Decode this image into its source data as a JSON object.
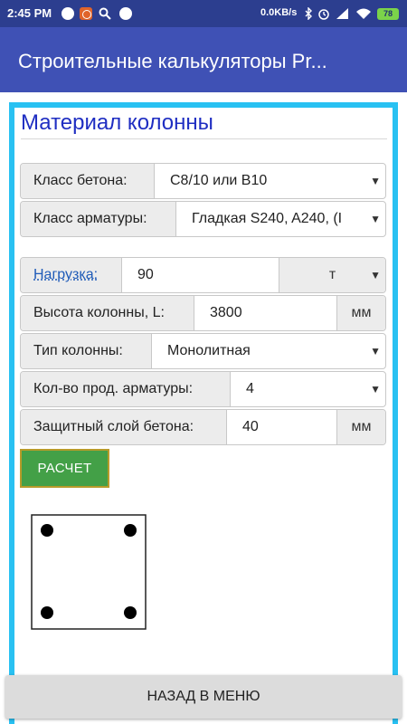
{
  "status_bar": {
    "time": "2:45 PM",
    "speed": "0.0KB/s",
    "battery": "78"
  },
  "app": {
    "title": "Строительные калькуляторы Pr..."
  },
  "section": {
    "heading": "Материал колонны"
  },
  "form": {
    "concrete_class": {
      "label": "Класс бетона:",
      "value": "C8/10 или B10"
    },
    "rebar_class": {
      "label": "Класс арматуры:",
      "value": "Гладкая S240, A240, (I"
    },
    "load": {
      "label": "Нагрузка:",
      "value": "90",
      "unit": "т"
    },
    "height": {
      "label": "Высота колонны, L:",
      "value": "3800",
      "unit": "мм"
    },
    "column_type": {
      "label": "Тип колонны:",
      "value": "Монолитная"
    },
    "rebar_count": {
      "label": "Кол-во прод. арматуры:",
      "value": "4"
    },
    "cover": {
      "label": "Защитный слой бетона:",
      "value": "40",
      "unit": "мм"
    }
  },
  "buttons": {
    "calculate": "РАСЧЕТ",
    "back": "НАЗАД В МЕНЮ"
  },
  "colors": {
    "status_bar": "#2c3e8f",
    "app_bar": "#3f51b5",
    "frame": "#29c1f2",
    "heading": "#1f2ec2",
    "calc_button": "#43a047"
  }
}
